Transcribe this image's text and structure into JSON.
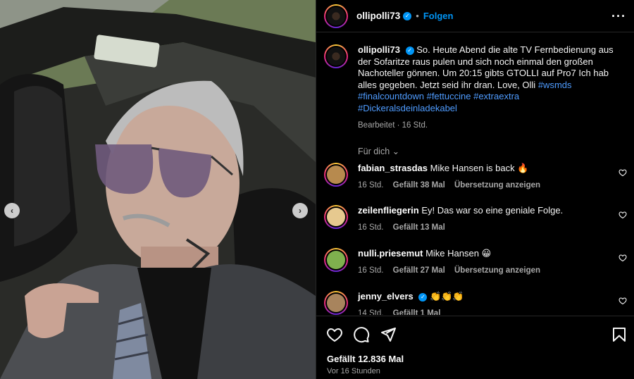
{
  "post": {
    "username": "ollipolli73",
    "follow_label": "Folgen",
    "more_icon": "more-options-icon"
  },
  "caption": {
    "username": "ollipolli73",
    "text": "So. Heute Abend die alte TV Fernbedienung aus der Sofaritze raus pulen und sich noch einmal den großen Nachoteller gönnen. Um 20:15 gibts GTOLLI auf Pro7 Ich hab alles gegeben. Jetzt seid ihr dran. Love, Olli",
    "hashtags": [
      "#wsmds",
      "#finalcountdown",
      "#fettuccine",
      "#extraextra",
      "#Dickeralsdeinladekabel"
    ],
    "meta": "Bearbeitet · 16 Std."
  },
  "for_you_label": "Für dich",
  "comments": [
    {
      "user": "fabian_strasdas",
      "text": "Mike Hansen is back 🔥",
      "time": "16 Std.",
      "likes": "Gefällt 38 Mal",
      "translate": "Übersetzung anzeigen",
      "verified": false
    },
    {
      "user": "zeilenfliegerin",
      "text": "Ey! Das war so eine geniale Folge.",
      "time": "16 Std.",
      "likes": "Gefällt 13 Mal",
      "translate": "",
      "verified": false
    },
    {
      "user": "nulli.priesemut",
      "text": "Mike Hansen 😀",
      "time": "16 Std.",
      "likes": "Gefällt 27 Mal",
      "translate": "Übersetzung anzeigen",
      "verified": false
    },
    {
      "user": "jenny_elvers",
      "text": "👏👏👏",
      "time": "14 Std.",
      "likes": "Gefällt 1 Mal",
      "translate": "",
      "verified": true
    }
  ],
  "footer": {
    "likes": "Gefällt 12.836 Mal",
    "time": "Vor 16 Stunden"
  },
  "colors": {
    "accent": "#0095f6",
    "hashtag": "#4f9cff",
    "muted": "#a8a8a8",
    "background": "#000000"
  }
}
